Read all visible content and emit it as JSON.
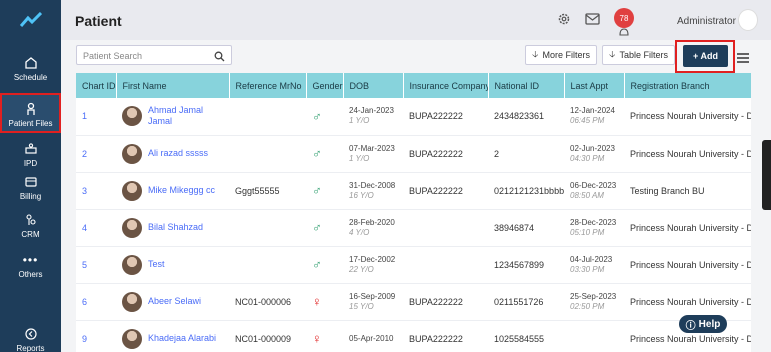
{
  "app": {
    "title": "Patient"
  },
  "header": {
    "notification_count": "78",
    "user": "Administrator"
  },
  "sidebar": {
    "items": [
      {
        "label": "Schedule",
        "icon": "home-icon"
      },
      {
        "label": "Patient Files",
        "icon": "person-icon",
        "active": true
      },
      {
        "label": "IPD",
        "icon": "bed-icon"
      },
      {
        "label": "Billing",
        "icon": "wallet-icon"
      },
      {
        "label": "CRM",
        "icon": "crm-icon"
      },
      {
        "label": "Others",
        "icon": "more-icon"
      },
      {
        "label": "Reports",
        "icon": "reports-icon"
      }
    ]
  },
  "toolbar": {
    "search_placeholder": "Patient Search",
    "more_filters": "More Filters",
    "table_filters": "Table Filters",
    "add": "+ Add"
  },
  "table": {
    "columns": [
      "Chart ID",
      "First Name",
      "Reference MrNo",
      "Gender",
      "DOB",
      "Insurance Company",
      "National ID",
      "Last Appt",
      "Registration Branch"
    ],
    "rows": [
      {
        "id": "1",
        "name": "Ahmad Jamal Jamal",
        "ref": "",
        "gender": "male",
        "dob": "24-Jan-2023",
        "age": "1 Y/O",
        "insurance": "BUPA222222",
        "national_id": "2434823361",
        "appt_date": "12-Jan-2024",
        "appt_time": "06:45 PM",
        "branch": "Princess Nourah University - Dental Fa"
      },
      {
        "id": "2",
        "name": "Ali razad sssss",
        "ref": "",
        "gender": "male",
        "dob": "07-Mar-2023",
        "age": "1 Y/O",
        "insurance": "BUPA222222",
        "national_id": "2",
        "appt_date": "02-Jun-2023",
        "appt_time": "04:30 PM",
        "branch": "Princess Nourah University - Dental Fa"
      },
      {
        "id": "3",
        "name": "Mike Mikeggg cc",
        "ref": "Gggt55555",
        "gender": "male",
        "dob": "31-Dec-2008",
        "age": "16 Y/O",
        "insurance": "BUPA222222",
        "national_id": "0212121231bbbbb",
        "appt_date": "06-Dec-2023",
        "appt_time": "08:50 AM",
        "branch": "Testing Branch BU"
      },
      {
        "id": "4",
        "name": "Bilal Shahzad",
        "ref": "",
        "gender": "male",
        "dob": "28-Feb-2020",
        "age": "4 Y/O",
        "insurance": "",
        "national_id": "38946874",
        "appt_date": "28-Dec-2023",
        "appt_time": "05:10 PM",
        "branch": "Princess Nourah University - Dental Fa"
      },
      {
        "id": "5",
        "name": "Test",
        "ref": "",
        "gender": "male",
        "dob": "17-Dec-2002",
        "age": "22 Y/O",
        "insurance": "",
        "national_id": "1234567899",
        "appt_date": "04-Jul-2023",
        "appt_time": "03:30 PM",
        "branch": "Princess Nourah University - Dental Fa"
      },
      {
        "id": "6",
        "name": "Abeer Selawi",
        "ref": "NC01-000006",
        "gender": "female",
        "dob": "16-Sep-2009",
        "age": "15 Y/O",
        "insurance": "BUPA222222",
        "national_id": "0211551726",
        "appt_date": "25-Sep-2023",
        "appt_time": "02:50 PM",
        "branch": "Princess Nourah University - Dental Fa"
      },
      {
        "id": "9",
        "name": "Khadejaa Alarabi",
        "ref": "NC01-000009",
        "gender": "female",
        "dob": "05-Apr-2010",
        "age": "",
        "insurance": "BUPA222222",
        "national_id": "1025584555",
        "appt_date": "",
        "appt_time": "",
        "branch": "Princess Nourah University - Dental Fa"
      }
    ]
  },
  "help": {
    "label": "Help"
  },
  "colors": {
    "sidebar": "#1e3d5a",
    "header_row": "#87d3dc",
    "link": "#4a6cf7",
    "highlight": "#e02020"
  }
}
